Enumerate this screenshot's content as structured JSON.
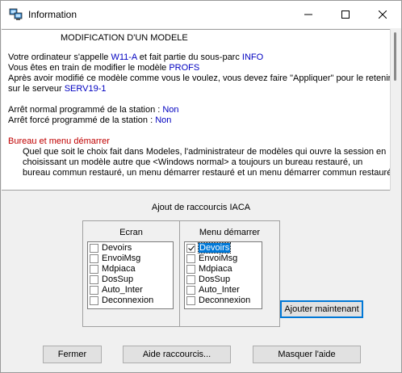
{
  "window": {
    "title": "Information",
    "controls": {
      "minimize": "minimize-icon",
      "maximize": "maximize-icon",
      "close": "close-icon"
    }
  },
  "message": {
    "heading": "MODIFICATION D'UN MODELE",
    "line1_a": "Votre ordinateur s'appelle ",
    "line1_computer": "W11-A",
    "line1_b": " et fait partie du sous-parc ",
    "line1_subpark": "INFO",
    "line2_a": "Vous êtes en train de modifier le modèle ",
    "line2_model": "PROFS",
    "line3": "Après avoir modifié ce modèle comme vous le voulez, vous devez faire \"Appliquer\" pour le retenir",
    "line4_a": "sur le serveur ",
    "line4_server": "SERV19-1",
    "normal_stop_label": "Arrêt normal programmé de la station : ",
    "normal_stop_value": "Non",
    "forced_stop_label": "Arrêt forcé programmé de la station : ",
    "forced_stop_value": "Non",
    "section_title": "Bureau et menu démarrer",
    "para1": "Quel que soit le choix fait dans Modeles, l'administrateur de modèles qui ouvre la session en",
    "para2": "choisissant un modèle autre que <Windows normal> a toujours un bureau restauré, un",
    "para3": "bureau commun restauré, un menu démarrer restauré et un menu démarrer commun restauré."
  },
  "shortcuts": {
    "title": "Ajout de raccourcis IACA",
    "ecran": {
      "label": "Ecran",
      "items": [
        {
          "label": "Devoirs",
          "checked": false
        },
        {
          "label": "EnvoiMsg",
          "checked": false
        },
        {
          "label": "Mdpiaca",
          "checked": false
        },
        {
          "label": "DosSup",
          "checked": false
        },
        {
          "label": "Auto_Inter",
          "checked": false
        },
        {
          "label": "Deconnexion",
          "checked": false
        }
      ]
    },
    "menu": {
      "label": "Menu démarrer",
      "items": [
        {
          "label": "Devoirs",
          "checked": true,
          "selected": true
        },
        {
          "label": "EnvoiMsg",
          "checked": false
        },
        {
          "label": "Mdpiaca",
          "checked": false
        },
        {
          "label": "DosSup",
          "checked": false
        },
        {
          "label": "Auto_Inter",
          "checked": false
        },
        {
          "label": "Deconnexion",
          "checked": false
        }
      ]
    },
    "add_button": "Ajouter maintenant"
  },
  "footer": {
    "close_button": "Fermer",
    "help_button": "Aide raccourcis...",
    "hide_help_button": "Masquer l'aide"
  },
  "colors": {
    "link": "#0000c0",
    "section": "#c00000",
    "selection": "#0078d7"
  }
}
